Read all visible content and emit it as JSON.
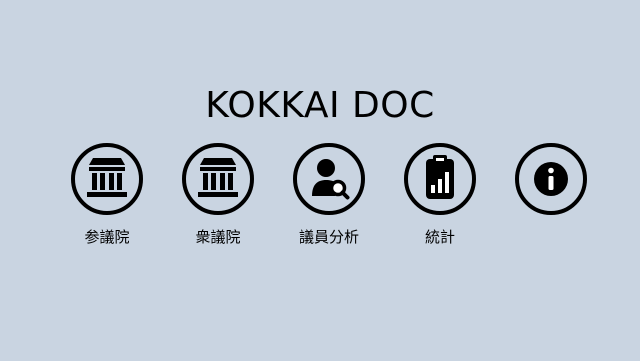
{
  "app": {
    "title": "KOKKAI DOC"
  },
  "nav": {
    "items": [
      {
        "label": "参議院",
        "icon": "building-icon"
      },
      {
        "label": "衆議院",
        "icon": "building-icon"
      },
      {
        "label": "議員分析",
        "icon": "person-search-icon"
      },
      {
        "label": "統計",
        "icon": "clipboard-chart-icon"
      },
      {
        "label": "",
        "icon": "info-icon"
      }
    ]
  },
  "colors": {
    "background": "#c9d4e1",
    "foreground": "#000000"
  }
}
